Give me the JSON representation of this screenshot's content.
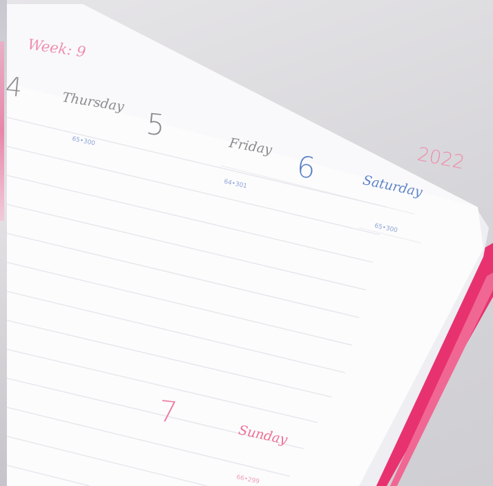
{
  "planner": {
    "week_label": "Week: 9",
    "year": "2022",
    "days": [
      {
        "number": "4",
        "name": "Thursday",
        "note": "65•300"
      },
      {
        "number": "5",
        "name": "Friday",
        "note": "64•301"
      },
      {
        "number": "6",
        "name": "Saturday",
        "note": "65•300"
      },
      {
        "number": "7",
        "name": "Sunday",
        "note": "66•299"
      }
    ]
  },
  "colors": {
    "accent_pink": "#ee7094",
    "accent_blue": "#5f84c8",
    "ribbon_pink": "#e8326f",
    "text_gray": "#8a8a8f",
    "page_white": "#fcfcfd"
  }
}
